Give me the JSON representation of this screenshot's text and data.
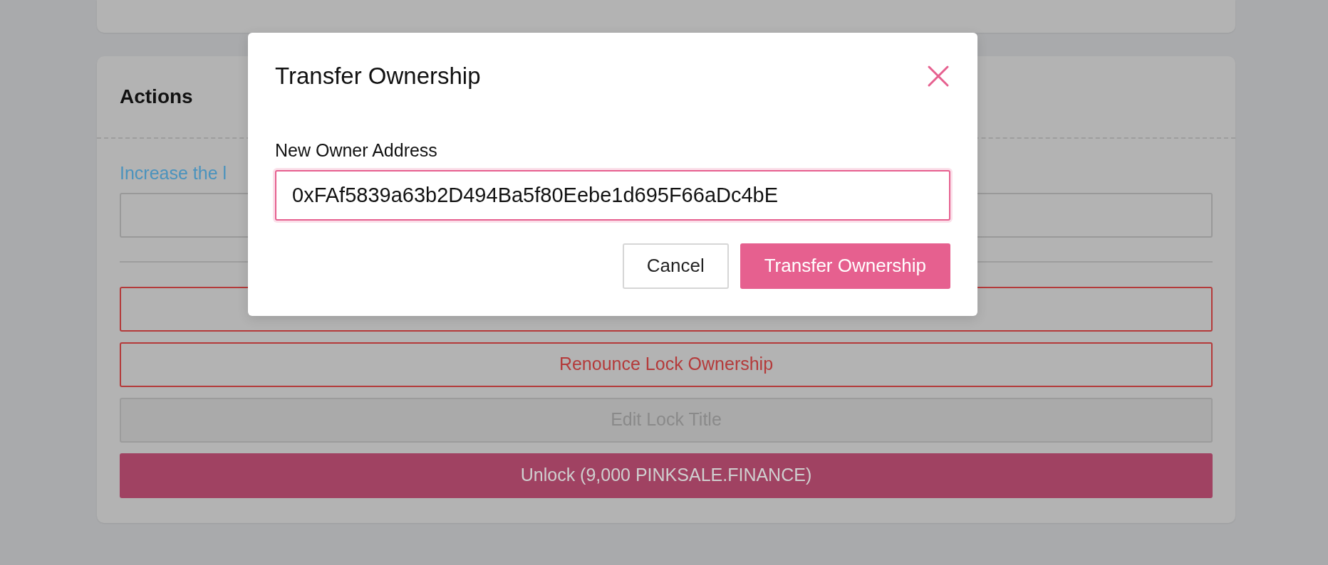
{
  "actions_card": {
    "title": "Actions",
    "link": "Increase the l",
    "buttons": [
      {
        "kind": "outline-danger"
      },
      {
        "kind": "outline-danger",
        "label": "Renounce Lock Ownership"
      },
      {
        "kind": "outline-secondary",
        "label": "Edit Lock Title"
      },
      {
        "kind": "primary",
        "label": "Unlock (9,000 PINKSALE.FINANCE)"
      }
    ]
  },
  "modal": {
    "title": "Transfer Ownership",
    "field": {
      "label": "New Owner Address",
      "value": "0xFAf5839a63b2D494Ba5f80Eebe1d695F66aDc4bE"
    },
    "buttons": [
      {
        "kind": "secondary",
        "label": "Cancel"
      },
      {
        "kind": "primary",
        "label": "Transfer Ownership"
      }
    ]
  }
}
